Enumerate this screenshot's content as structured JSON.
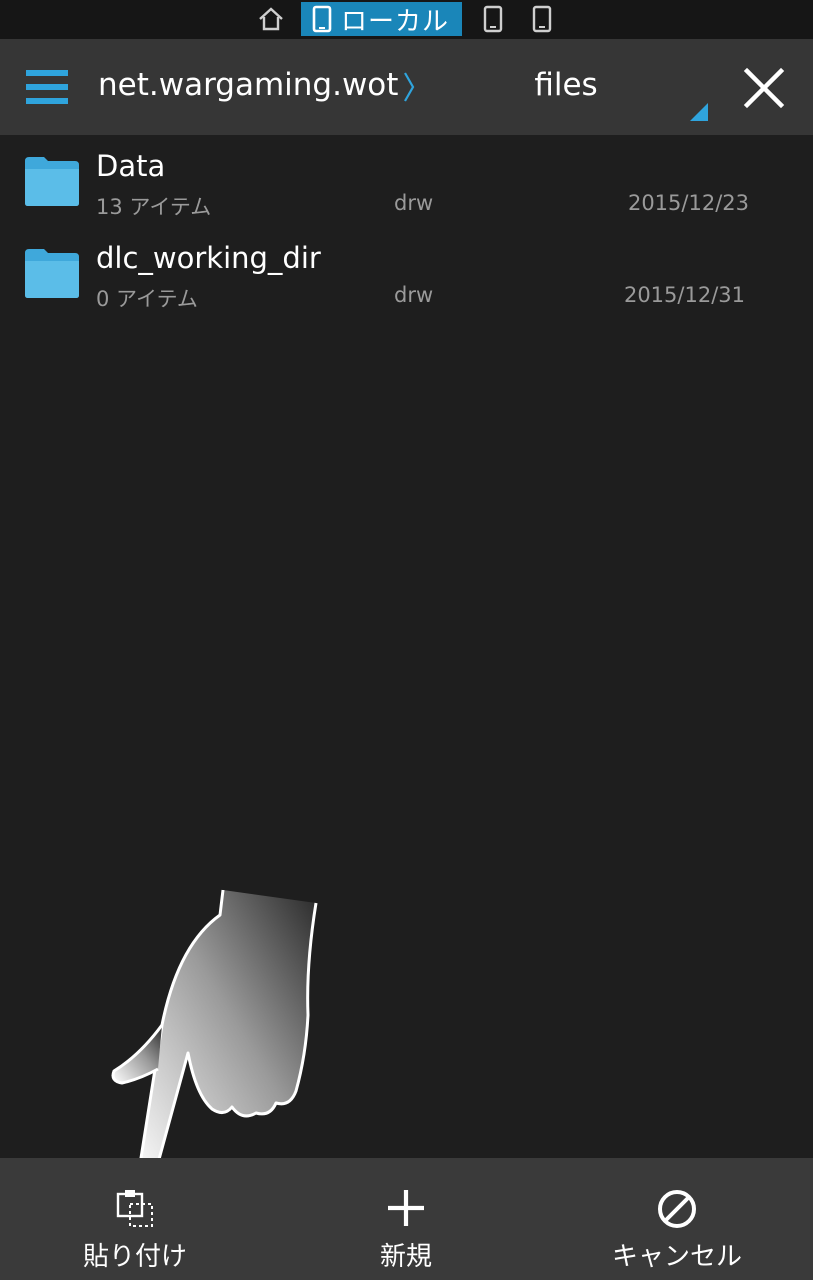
{
  "location_bar": {
    "active_label": "ローカル",
    "icons": [
      "home-icon",
      "device-icon",
      "device-icon",
      "device-icon"
    ]
  },
  "header": {
    "menu_icon": "hamburger-icon",
    "parent_path": "net.wargaming.wot...",
    "separator_icon": "chevron-right-icon",
    "current_folder": "files",
    "close_icon": "close-icon"
  },
  "files": [
    {
      "name": "Data",
      "items": "13 アイテム",
      "perm": "drw",
      "date": "2015/12/23",
      "icon": "folder-icon"
    },
    {
      "name": "dlc_working_dir",
      "items": "0 アイテム",
      "perm": "drw",
      "date": "2015/12/31",
      "icon": "folder-icon"
    }
  ],
  "actions": {
    "paste_label": "貼り付け",
    "new_label": "新規",
    "cancel_label": "キャンセル"
  },
  "colors": {
    "background": "#1e1e1e",
    "header": "#363636",
    "accent": "#1a86b9",
    "folder": "#5bbde8",
    "action_bar": "#3a3a3a"
  }
}
